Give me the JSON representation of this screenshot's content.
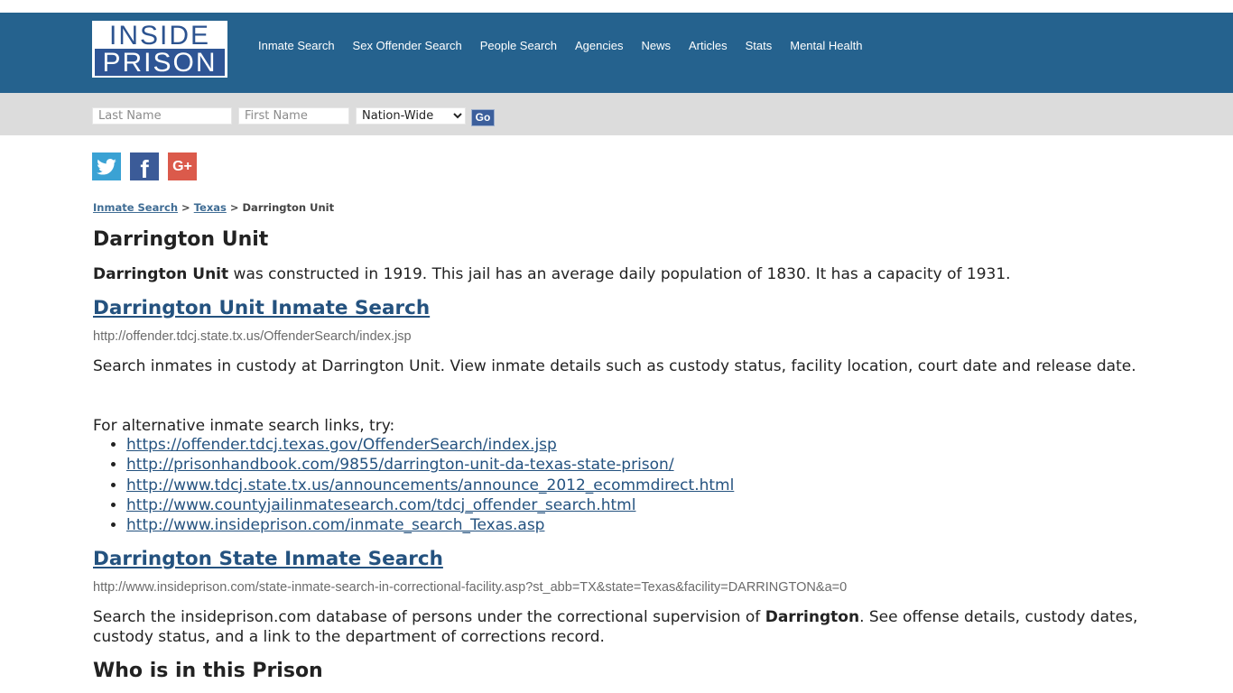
{
  "brand": {
    "logo_line1": "INSIDE",
    "logo_line2": "PRISON",
    "header_color": "#25628e"
  },
  "nav": {
    "items": [
      {
        "label": "Inmate Search"
      },
      {
        "label": "Sex Offender Search"
      },
      {
        "label": "People Search"
      },
      {
        "label": "Agencies"
      },
      {
        "label": "News"
      },
      {
        "label": "Articles"
      },
      {
        "label": "Stats"
      },
      {
        "label": "Mental Health"
      }
    ]
  },
  "search": {
    "last_name_placeholder": "Last Name",
    "first_name_placeholder": "First Name",
    "scope_selected": "Nation-Wide",
    "go_label": "Go"
  },
  "social": {
    "twitter_icon": "twitter-icon",
    "facebook_icon": "facebook-icon",
    "facebook_glyph": "f",
    "googleplus_icon": "google-plus-icon",
    "googleplus_glyph": "G+"
  },
  "breadcrumb": {
    "items": [
      {
        "label": "Inmate Search"
      },
      {
        "label": "Texas"
      },
      {
        "label": "Darrington Unit"
      }
    ],
    "separator": ">"
  },
  "page": {
    "title": "Darrington Unit",
    "intro_bold": "Darrington Unit",
    "intro_rest": " was constructed in 1919. This jail has an average daily population of 1830. It has a capacity of 1931.",
    "section1": {
      "heading": "Darrington Unit Inmate Search",
      "url": "http://offender.tdcj.state.tx.us/OffenderSearch/index.jsp",
      "description": "Search inmates in custody at Darrington Unit. View inmate details such as custody status, facility location, court date and release date.",
      "alt_intro": "For alternative inmate search links, try:",
      "alt_links": [
        "https://offender.tdcj.texas.gov/OffenderSearch/index.jsp",
        "http://prisonhandbook.com/9855/darrington-unit-da-texas-state-prison/",
        "http://www.tdcj.state.tx.us/announcements/announce_2012_ecommdirect.html",
        "http://www.countyjailinmatesearch.com/tdcj_offender_search.html",
        "http://www.insideprison.com/inmate_search_Texas.asp"
      ]
    },
    "section2": {
      "heading": "Darrington State Inmate Search",
      "url": "http://www.insideprison.com/state-inmate-search-in-correctional-facility.asp?st_abb=TX&state=Texas&facility=DARRINGTON&a=0",
      "description_pre": "Search the insideprison.com database of persons under the correctional supervision of ",
      "description_bold": "Darrington",
      "description_post": ". See offense details, custody dates, custody status, and a link to the department of corrections record."
    },
    "section3": {
      "heading": "Who is in this Prison"
    }
  }
}
